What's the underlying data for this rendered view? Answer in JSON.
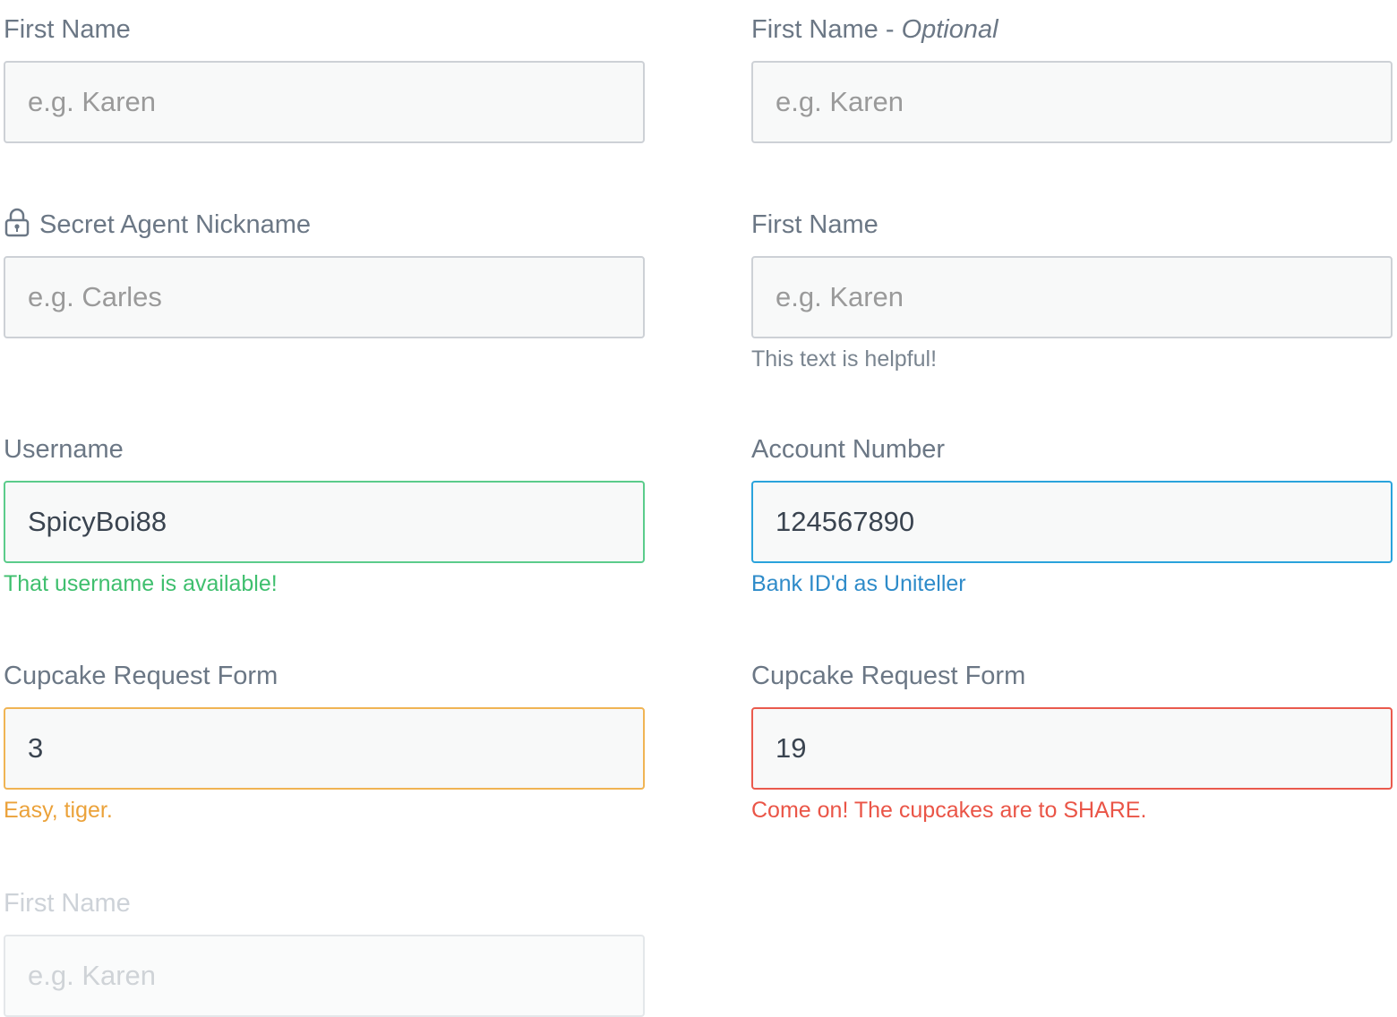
{
  "fields": {
    "basic": {
      "label": "First Name",
      "placeholder": "e.g. Karen"
    },
    "optional": {
      "label": "First Name - ",
      "optional_text": "Optional",
      "placeholder": "e.g. Karen"
    },
    "secret": {
      "label": "Secret Agent Nickname",
      "placeholder": "e.g. Carles",
      "icon": "lock-icon"
    },
    "helper": {
      "label": "First Name",
      "placeholder": "e.g. Karen",
      "help": "This text is helpful!"
    },
    "username": {
      "label": "Username",
      "value": "SpicyBoi88",
      "help": "That username is available!",
      "state": "success"
    },
    "account": {
      "label": "Account Number",
      "value": "124567890",
      "help": "Bank ID'd as Uniteller",
      "state": "info"
    },
    "cupcake_warning": {
      "label": "Cupcake Request Form",
      "value": "3",
      "help": "Easy, tiger.",
      "state": "warning"
    },
    "cupcake_error": {
      "label": "Cupcake Request Form",
      "value": "19",
      "help": "Come on! The cupcakes are to SHARE.",
      "state": "error"
    },
    "disabled": {
      "label": "First Name",
      "placeholder": "e.g. Karen",
      "state": "disabled"
    }
  },
  "colors": {
    "success": "#3fbf6e",
    "info": "#2e8bc9",
    "warning": "#eba23a",
    "error": "#ea5547"
  }
}
